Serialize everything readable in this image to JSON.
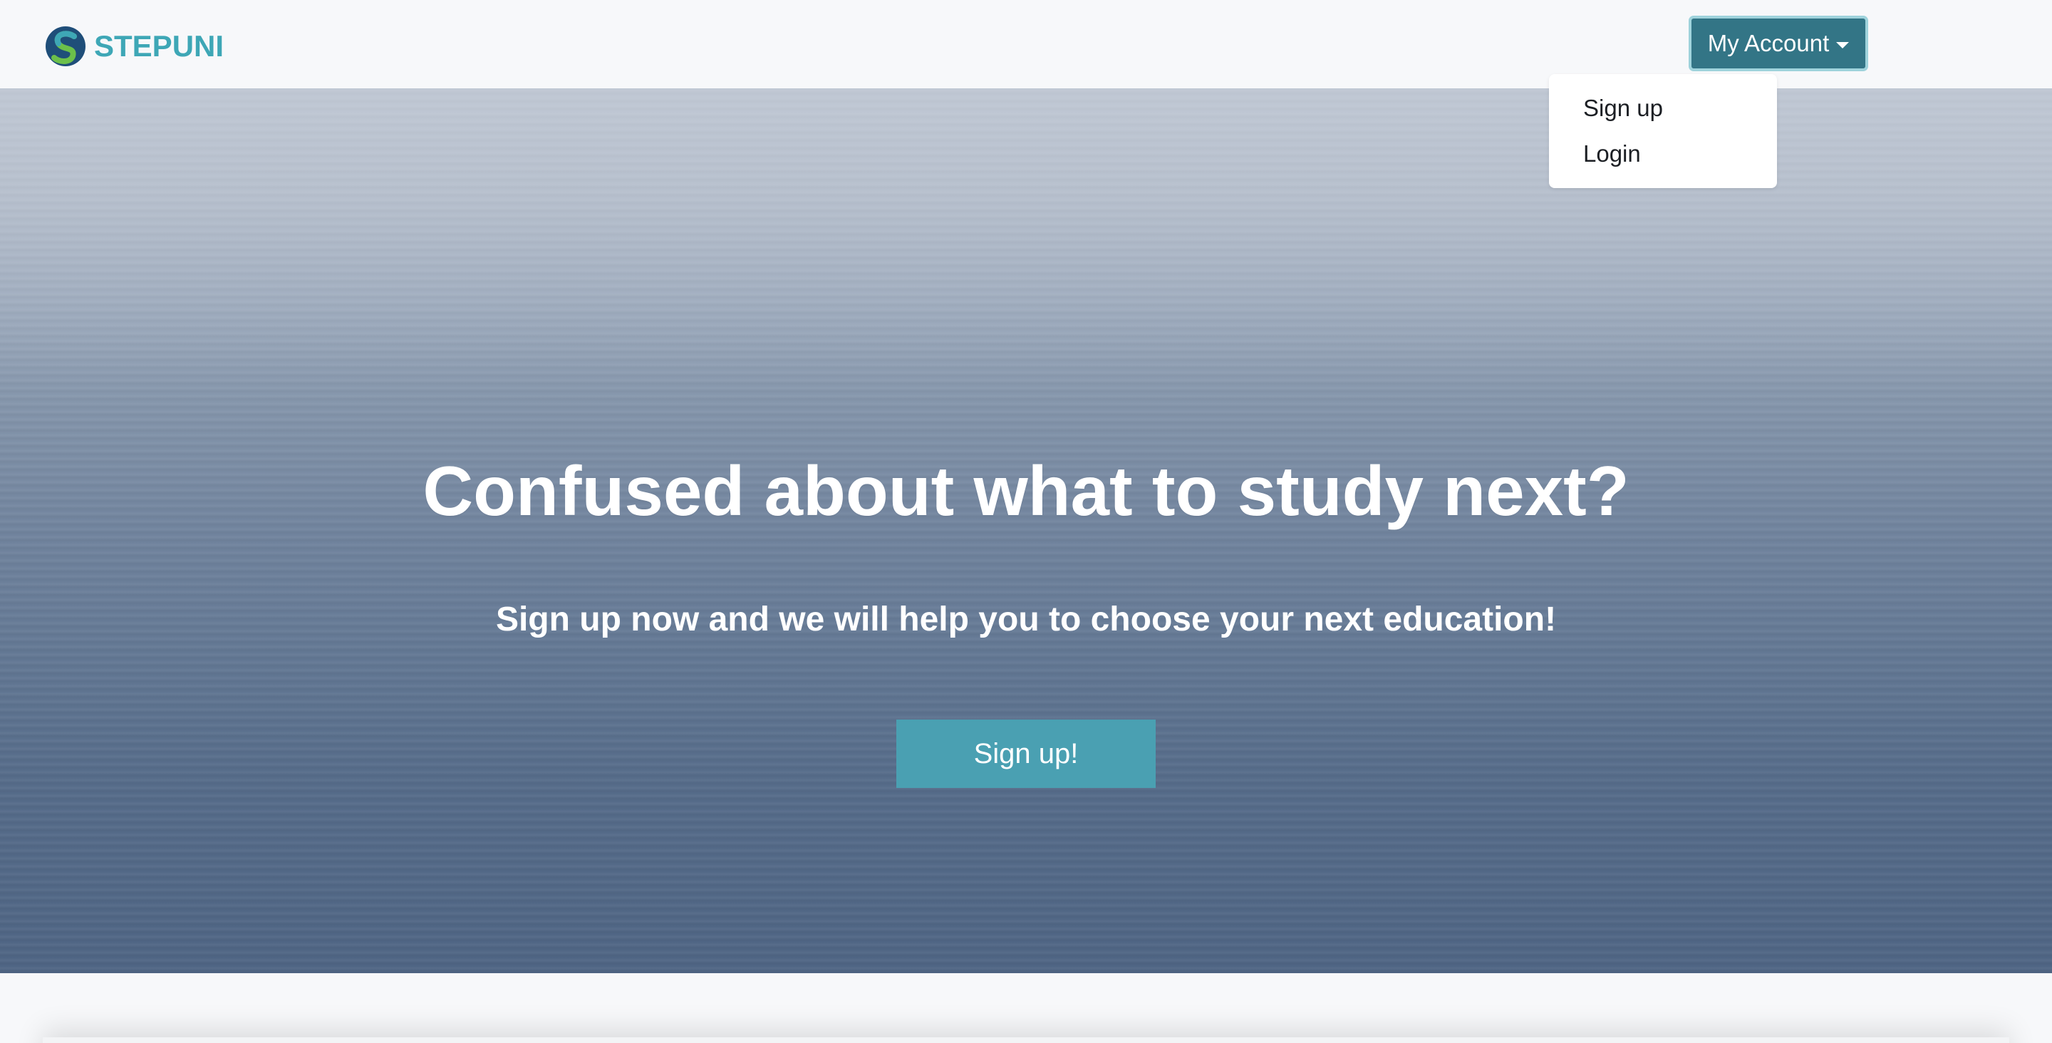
{
  "navbar": {
    "brand_name": "STEPUNI",
    "brand_logo_icon": "stepuni-logo-icon",
    "account_button_label": "My Account",
    "account_caret_icon": "caret-down-icon",
    "dropdown": {
      "items": [
        {
          "label": "Sign up"
        },
        {
          "label": "Login"
        }
      ]
    }
  },
  "hero": {
    "title": "Confused about what to study next?",
    "subtitle": "Sign up now and we will help you to choose your next education!",
    "cta_label": "Sign up!"
  },
  "colors": {
    "brand": "#3ea7b6",
    "account_button": "#337586",
    "cta_button": "#4aa0b2",
    "page_background": "#f7f8fa"
  }
}
